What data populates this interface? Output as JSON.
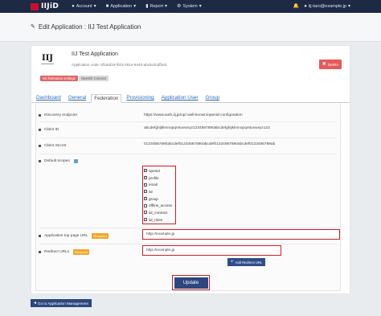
{
  "topbar": {
    "brand": "IIJ",
    "brand_suffix": "iD",
    "menu": [
      {
        "label": "Account",
        "icon": "user-icon"
      },
      {
        "label": "Application",
        "icon": "grid-icon"
      },
      {
        "label": "Report",
        "icon": "chart-icon"
      },
      {
        "label": "System",
        "icon": "gear-icon"
      }
    ],
    "notification_count": "",
    "user_email": "iij-taro@example.jp"
  },
  "header": {
    "title": "Edit Application : IIJ Test Application"
  },
  "app": {
    "logo_text": "IIJ",
    "name": "IIJ Test Application",
    "code": "Application code: 6f19af19-f023-491e-844d-abc5cdcdfba3",
    "badge_federation": "No federation settings",
    "badge_openid": "OpenID Connect",
    "delete_label": "Delete"
  },
  "tabs": [
    {
      "label": "Dashboard",
      "active": false
    },
    {
      "label": "General",
      "active": false
    },
    {
      "label": "Federation",
      "active": true
    },
    {
      "label": "Provisioning",
      "active": false
    },
    {
      "label": "Application User",
      "active": false
    },
    {
      "label": "Group",
      "active": false
    }
  ],
  "form": {
    "discovery_label": "Discovery endpoint",
    "discovery_value": "https://www.auth.iij.jp/op/.well-known/openid-configuration",
    "client_id_label": "Client ID",
    "client_id_value": "abcdefghijklmnopqrstuvwxyz1234567890abcdefghijklmnopqrstuvwxyz123",
    "client_secret_label": "Client Secret",
    "client_secret_value": "01234567890abcdef01234567890abcdef01234567890abcdef0123456789ab",
    "scopes_label": "Default scopes",
    "scopes": [
      {
        "name": "openid",
        "checked": true
      },
      {
        "name": "profile",
        "checked": true
      },
      {
        "name": "email",
        "checked": true
      },
      {
        "name": "iid",
        "checked": true
      },
      {
        "name": "group",
        "checked": true
      },
      {
        "name": "offline_access",
        "checked": false
      },
      {
        "name": "iid_contract",
        "checked": false
      },
      {
        "name": "iid_roles",
        "checked": false
      }
    ],
    "top_url_label": "Application top page URL",
    "required_label": "Required",
    "top_url_value": "http://example.jp",
    "redirect_label": "Redirect URLs",
    "redirect_value": "http://example.jp",
    "add_redirect_label": "Add Redirect URL",
    "update_label": "Update"
  },
  "footer": {
    "back_label": "Go to Application Management"
  },
  "colors": {
    "accent": "#2c477f",
    "highlight": "#c81f2a",
    "required": "#f0a626",
    "danger": "#e85a5a"
  }
}
